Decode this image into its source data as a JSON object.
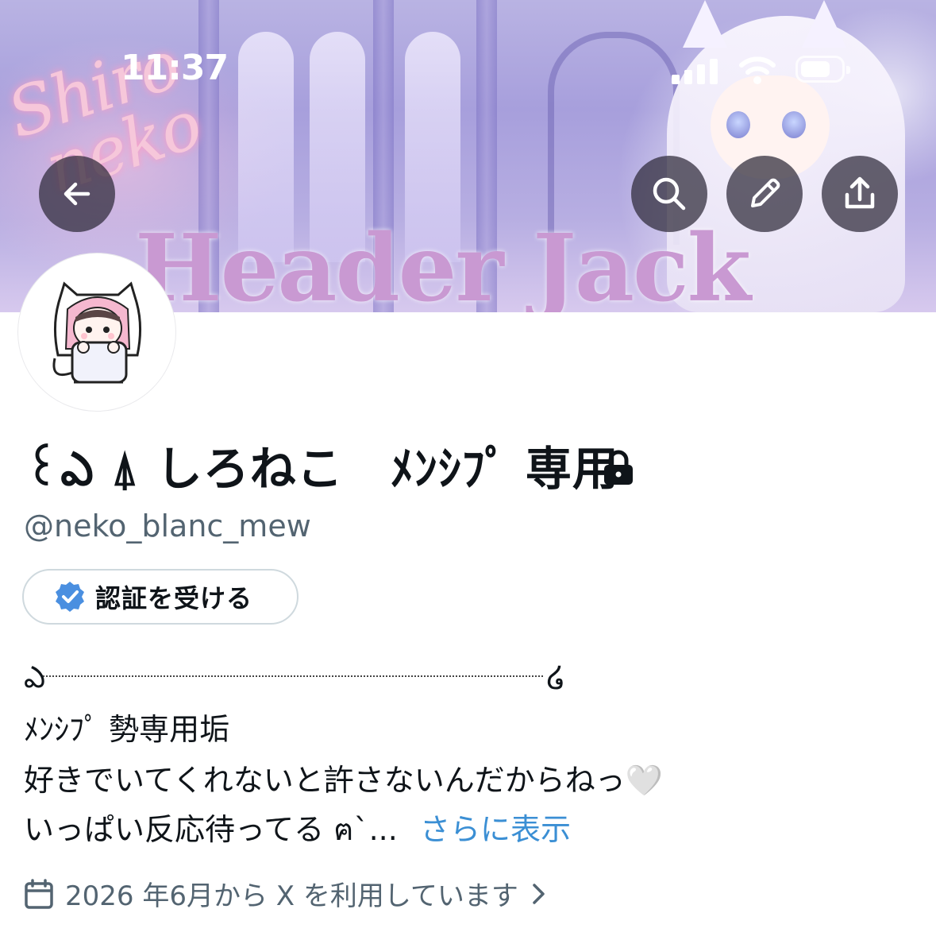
{
  "status_bar": {
    "time": "11:37"
  },
  "banner": {
    "script_text": "Shiro\n neko",
    "title_text": "Header Jack"
  },
  "header_buttons": {
    "back_icon": "arrow-left-icon",
    "search_icon": "search-icon",
    "edit_icon": "pencil-icon",
    "share_icon": "share-icon"
  },
  "profile": {
    "display_name": "꒰ఎ ⍋ しろねこ　ﾒﾝｼﾌﾟ 専用",
    "handle": "@neko_blanc_mew",
    "verify_label": "認証を受ける",
    "bio": {
      "deco_left": "ఎ",
      "deco_right": "໒",
      "line1": "ﾒﾝｼﾌﾟ 勢専用垢",
      "line2": "好きでいてくれないと許さないんだからねっ🤍",
      "line3": "いっぱい反応待ってる ฅ`...",
      "more": "さらに表示"
    },
    "joined": "2026 年6月から X を利用しています"
  },
  "colors": {
    "accent_link": "#3b8fd4",
    "verified_badge": "#4a8fe0",
    "secondary_text": "#536471"
  }
}
